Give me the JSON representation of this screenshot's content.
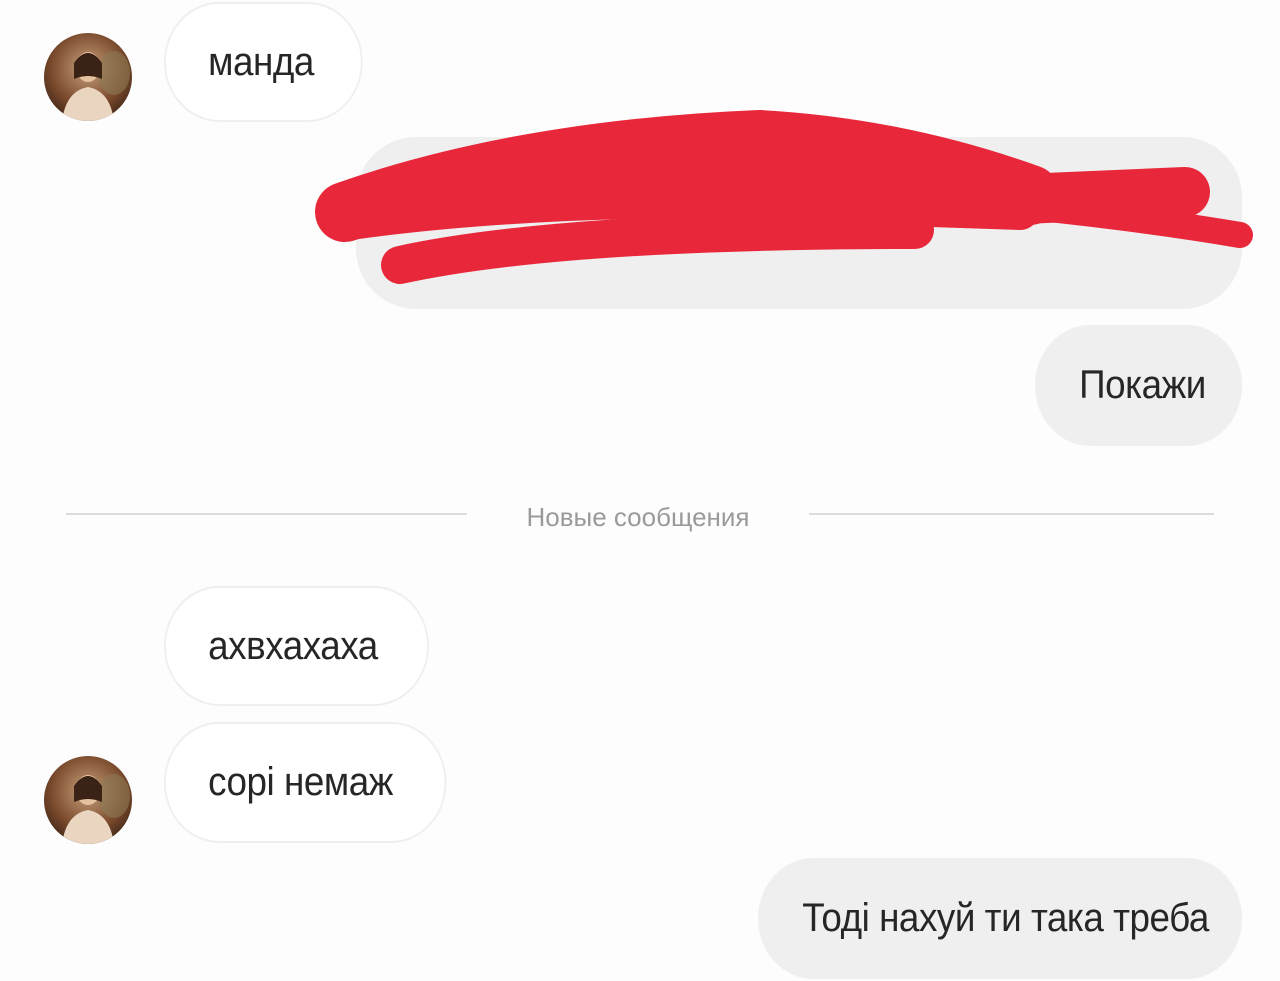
{
  "messages": {
    "m1": {
      "text": "манда",
      "direction": "incoming"
    },
    "m2": {
      "text": "",
      "direction": "outgoing",
      "redacted": true,
      "redaction_color": "#e8283a"
    },
    "m3": {
      "text": "Покажи",
      "direction": "outgoing"
    },
    "m4": {
      "text": "ахвхахаха",
      "direction": "incoming"
    },
    "m5": {
      "text": "сорі немаж",
      "direction": "incoming"
    },
    "m6": {
      "text": "Тоді нахуй ти така треба",
      "direction": "outgoing"
    }
  },
  "divider": {
    "label": "Новые сообщения"
  },
  "colors": {
    "background": "#fdfdfd",
    "incoming_bubble": "#ffffff",
    "incoming_border": "#efefef",
    "outgoing_bubble": "#efefef",
    "text": "#262626",
    "divider": "#dcdcdc",
    "redaction": "#e8283a"
  }
}
